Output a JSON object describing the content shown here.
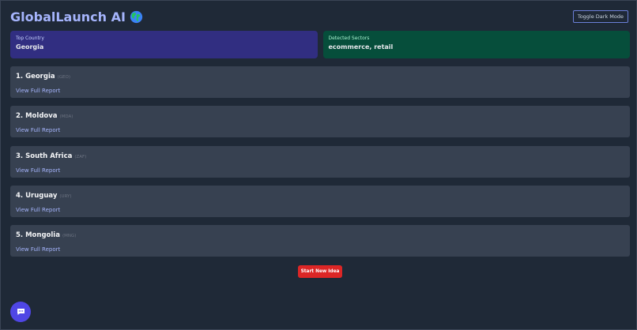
{
  "header": {
    "title": "GlobalLaunch AI",
    "title_icon": "globe-icon",
    "toggle_label": "Toggle Dark Mode"
  },
  "summary": {
    "top_country_label": "Top Country",
    "top_country_value": "Georgia",
    "sectors_label": "Detected Sectors",
    "sectors_value": "ecommerce, retail"
  },
  "countries": [
    {
      "rank_name": "1. Georgia",
      "code": "(GEO)",
      "link": "View Full Report"
    },
    {
      "rank_name": "2. Moldova",
      "code": "(MDA)",
      "link": "View Full Report"
    },
    {
      "rank_name": "3. South Africa",
      "code": "(ZAF)",
      "link": "View Full Report"
    },
    {
      "rank_name": "4. Uruguay",
      "code": "(URY)",
      "link": "View Full Report"
    },
    {
      "rank_name": "5. Mongolia",
      "code": "(MNG)",
      "link": "View Full Report"
    }
  ],
  "actions": {
    "start_new_label": "Start New Idea",
    "chat_icon": "chat-icon"
  },
  "colors": {
    "background": "#1f2937",
    "accent": "#a5b4fc",
    "country_card": "#312e81",
    "sectors_card": "#064e3b",
    "start_button": "#dc2626",
    "chat_button": "#4f46e5"
  }
}
